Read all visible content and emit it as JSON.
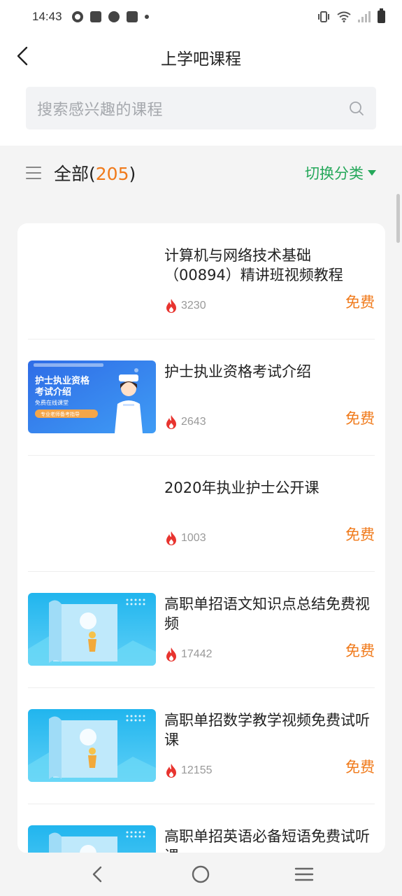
{
  "status": {
    "time": "14:43"
  },
  "header": {
    "title": "上学吧课程"
  },
  "search": {
    "placeholder": "搜索感兴趣的课程"
  },
  "filter": {
    "all_label": "全部(",
    "count": "205",
    "close_paren": ")",
    "switch_label": "切换分类"
  },
  "courses": [
    {
      "title": "计算机与网络技术基础（00894）精讲班视频教程",
      "views": "3230",
      "price": "免费",
      "thumb": "blank"
    },
    {
      "title": "护士执业资格考试介绍",
      "views": "2643",
      "price": "免费",
      "thumb": "nurse",
      "thumb_text": {
        "line1": "护士执业资格",
        "line2": "考试介绍",
        "line3": "免费在线课堂",
        "line4": "专业老师备考指导"
      }
    },
    {
      "title": "2020年执业护士公开课",
      "views": "1003",
      "price": "免费",
      "thumb": "blank"
    },
    {
      "title": "高职单招语文知识点总结免费视频",
      "views": "17442",
      "price": "免费",
      "thumb": "scroll"
    },
    {
      "title": "高职单招数学教学视频免费试听课",
      "views": "12155",
      "price": "免费",
      "thumb": "scroll"
    },
    {
      "title": "高职单招英语必备短语免费试听课",
      "views": "",
      "price": "",
      "thumb": "scroll"
    }
  ],
  "colors": {
    "accent_orange": "#f07a1b",
    "accent_green": "#25a85a",
    "fire": "#e8342f"
  }
}
